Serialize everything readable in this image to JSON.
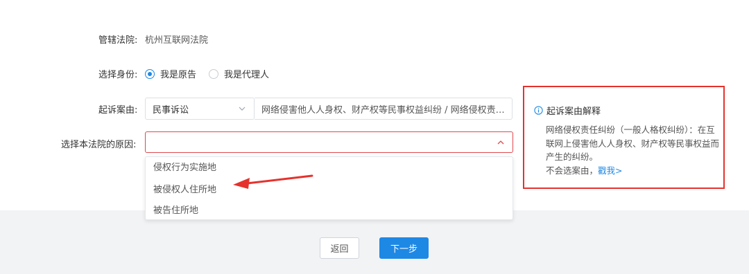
{
  "court": {
    "label": "管辖法院:",
    "value": "杭州互联网法院"
  },
  "identity": {
    "label": "选择身份:",
    "options": [
      {
        "label": "我是原告",
        "checked": true
      },
      {
        "label": "我是代理人",
        "checked": false
      }
    ]
  },
  "cause": {
    "label": "起诉案由:",
    "category": "民事诉讼",
    "detail": "网络侵害他人人身权、财产权等民事权益纠纷 / 网络侵权责任纠纷"
  },
  "reason": {
    "label": "选择本法院的原因:",
    "value": "",
    "options": [
      "侵权行为实施地",
      "被侵权人住所地",
      "被告住所地"
    ]
  },
  "explanation": {
    "title": "起诉案由解释",
    "body": "网络侵权责任纠纷（一般人格权纠纷）：在互联网上侵害他人人身权、财产权等民事权益而产生的纠纷。",
    "help_prefix": "不会选案由，",
    "help_link": "戳我>"
  },
  "buttons": {
    "back": "返回",
    "next": "下一步"
  },
  "colors": {
    "primary": "#1e88e5",
    "highlight_border": "#e5322d",
    "arrow": "#e5322d",
    "footer_bg": "#f2f3f5"
  }
}
